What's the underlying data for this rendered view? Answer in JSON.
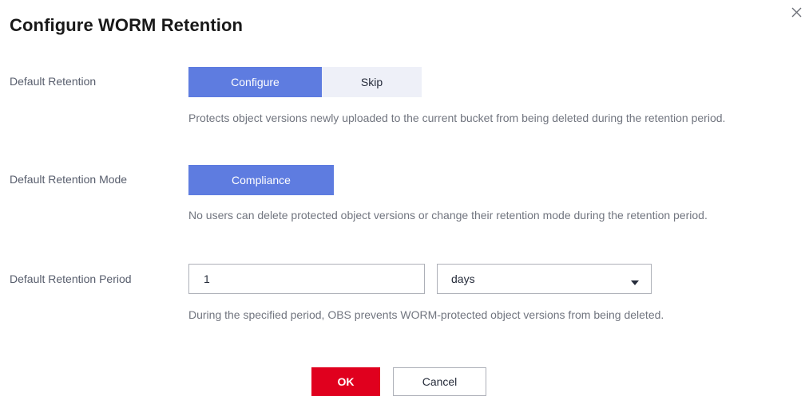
{
  "dialog": {
    "title": "Configure WORM Retention",
    "close_icon": "close-icon"
  },
  "default_retention": {
    "label": "Default Retention",
    "options": [
      {
        "label": "Configure",
        "selected": true
      },
      {
        "label": "Skip",
        "selected": false
      }
    ],
    "help": "Protects object versions newly uploaded to the current bucket from being deleted during the retention period."
  },
  "retention_mode": {
    "label": "Default Retention Mode",
    "options": [
      {
        "label": "Compliance",
        "selected": true
      }
    ],
    "help": "No users can delete protected object versions or change their retention mode during the retention period."
  },
  "retention_period": {
    "label": "Default Retention Period",
    "value": "1",
    "unit": "days",
    "caret_icon": "caret-down-icon",
    "help": "During the specified period, OBS prevents WORM-protected object versions from being deleted."
  },
  "footer": {
    "ok_label": "OK",
    "cancel_label": "Cancel"
  },
  "colors": {
    "accent": "#5e7ce0",
    "danger": "#e0001e",
    "inactive": "#eef0f8"
  }
}
